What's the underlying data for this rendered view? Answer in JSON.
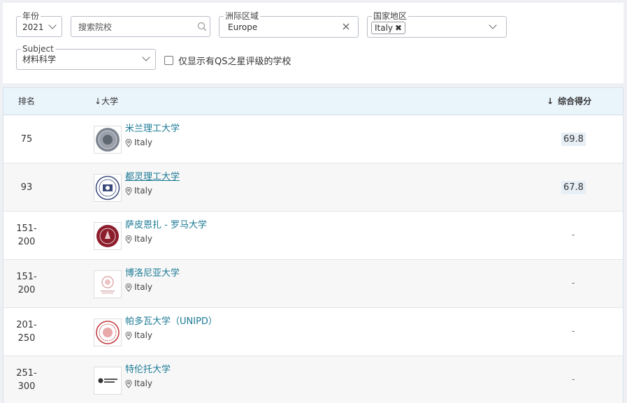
{
  "filters": {
    "year": {
      "label": "年份",
      "value": "2021"
    },
    "search": {
      "placeholder": "搜索院校"
    },
    "region": {
      "label": "洲际区域",
      "value": "Europe"
    },
    "country": {
      "label": "国家地区",
      "chip": "Italy"
    },
    "subject": {
      "label": "Subject",
      "value": "材料科学"
    },
    "qs_stars_only": {
      "label": "仅显示有QS之星评级的学校",
      "checked": false
    }
  },
  "table": {
    "headers": {
      "rank": "排名",
      "university": "大学",
      "score": "综合得分"
    },
    "rows": [
      {
        "rank": "75",
        "name": "米兰理工大学",
        "location": "Italy",
        "score": "69.8",
        "logo": "polimi-seal"
      },
      {
        "rank": "93",
        "name": "都灵理工大学",
        "location": "Italy",
        "score": "67.8",
        "logo": "polito-seal"
      },
      {
        "rank": "151-\n200",
        "name": "萨皮恩扎 - 罗马大学",
        "location": "Italy",
        "score": "-",
        "logo": "sapienza-seal"
      },
      {
        "rank": "151-\n200",
        "name": "博洛尼亚大学",
        "location": "Italy",
        "score": "-",
        "logo": "unibo-seal"
      },
      {
        "rank": "201-\n250",
        "name": "帕多瓦大学（UNIPD）",
        "location": "Italy",
        "score": "-",
        "logo": "unipd-seal"
      },
      {
        "rank": "251-\n300",
        "name": "特伦托大学",
        "location": "Italy",
        "score": "-",
        "logo": "unitn-logo"
      }
    ]
  },
  "colors": {
    "link": "#1b7a95",
    "header_bg": "#eaf4fb",
    "score_bg": "#e6eef6"
  }
}
